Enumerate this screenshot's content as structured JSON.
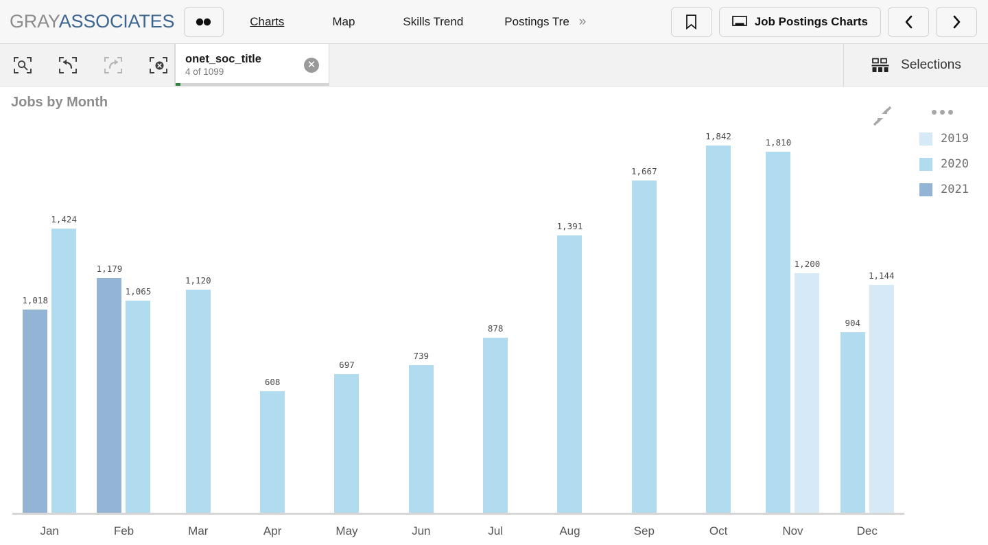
{
  "header": {
    "brand_first": "GRAY",
    "brand_second": "ASSOCIATES",
    "menu_icon": "ellipsis-icon",
    "nav": [
      {
        "label": "Charts",
        "active": true
      },
      {
        "label": "Map",
        "active": false
      },
      {
        "label": "Skills Trend",
        "active": false
      },
      {
        "label": "Postings Tre",
        "active": false
      }
    ],
    "nav_overflow": "»",
    "bookmark_icon": "bookmark-icon",
    "sheet_icon": "sheet-icon",
    "sheet_name": "Job Postings Charts",
    "prev_label": "‹",
    "next_label": "›"
  },
  "toolbar": {
    "icons": [
      {
        "name": "selection-search-icon",
        "disabled": false
      },
      {
        "name": "step-back-icon",
        "disabled": false
      },
      {
        "name": "step-forward-icon",
        "disabled": true
      },
      {
        "name": "clear-selections-icon",
        "disabled": false
      }
    ],
    "filter_chip": {
      "field": "onet_soc_title",
      "count_text": "4 of 1099",
      "clear_icon": "close-circle-icon"
    },
    "selections_icon": "selections-bar-icon",
    "selections_label": "Selections"
  },
  "chart": {
    "title": "Jobs by Month",
    "collapse_icon": "collapse-icon",
    "menu_icon": "kebab-menu-icon",
    "legend_position": "right"
  },
  "chart_data": {
    "type": "bar",
    "title": "Jobs by Month",
    "xlabel": "",
    "ylabel": "",
    "grid": false,
    "ylim": [
      0,
      2000
    ],
    "categories": [
      "Jan",
      "Feb",
      "Mar",
      "Apr",
      "May",
      "Jun",
      "Jul",
      "Aug",
      "Sep",
      "Oct",
      "Nov",
      "Dec"
    ],
    "legend": [
      "2019",
      "2020",
      "2021"
    ],
    "colors": {
      "2019": "#d6e9f6",
      "2020": "#b1dcef",
      "2021": "#93b4d5"
    },
    "series": [
      {
        "name": "2019",
        "values": [
          null,
          null,
          null,
          null,
          null,
          null,
          null,
          null,
          null,
          null,
          1200,
          1144
        ],
        "labels": [
          "",
          "",
          "",
          "",
          "",
          "",
          "",
          "",
          "",
          "",
          "1,200",
          "1,144"
        ]
      },
      {
        "name": "2020",
        "values": [
          1424,
          1065,
          1120,
          608,
          697,
          739,
          878,
          1391,
          1667,
          1842,
          1810,
          904
        ],
        "labels": [
          "1,424",
          "1,065",
          "1,120",
          "608",
          "697",
          "739",
          "878",
          "1,391",
          "1,667",
          "1,842",
          "1,810",
          "904"
        ]
      },
      {
        "name": "2021",
        "values": [
          1018,
          1179,
          null,
          null,
          null,
          null,
          null,
          null,
          null,
          null,
          null,
          null
        ],
        "labels": [
          "1,018",
          "1,179",
          "",
          "",
          "",
          "",
          "",
          "",
          "",
          "",
          "",
          ""
        ]
      }
    ],
    "bar_order_per_group": [
      [
        "2021",
        "2020"
      ],
      [
        "2021",
        "2020"
      ],
      [
        "2020"
      ],
      [
        "2020"
      ],
      [
        "2020"
      ],
      [
        "2020"
      ],
      [
        "2020"
      ],
      [
        "2020"
      ],
      [
        "2020"
      ],
      [
        "2020"
      ],
      [
        "2020",
        "2019"
      ],
      [
        "2020",
        "2019"
      ]
    ]
  }
}
